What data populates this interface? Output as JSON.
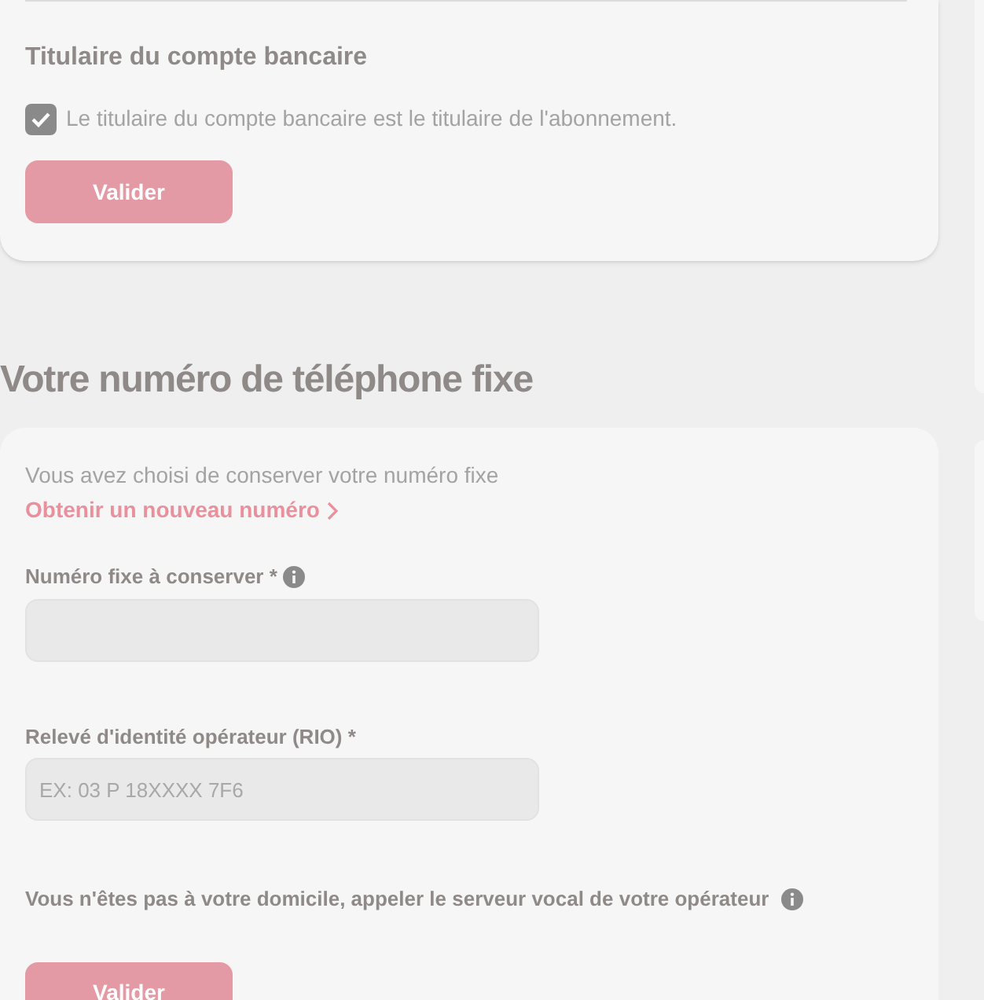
{
  "bank_holder": {
    "title": "Titulaire du compte bancaire",
    "checkbox": {
      "label": "Le titulaire du compte bancaire est le titulaire de l'abonnement.",
      "checked": true
    },
    "button": "Valider"
  },
  "phone": {
    "title": "Votre numéro de téléphone fixe",
    "note": "Vous avez choisi de conserver votre numéro fixe",
    "link": "Obtenir un nouveau numéro",
    "fields": [
      {
        "label": "Numéro fixe à conserver *",
        "info": true
      },
      {
        "label": "Relevé d'identité opérateur (RIO) *",
        "info": false,
        "placeholder": "EX: 03 P 18XXXX 7F6"
      }
    ],
    "hint": "Vous n'êtes pas à votre domicile, appeler le serveur vocal de votre opérateur",
    "button": "Valider"
  }
}
